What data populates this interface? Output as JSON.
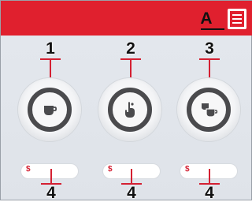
{
  "callouts": {
    "menu": "A",
    "button_1": "1",
    "button_2": "2",
    "button_3": "3",
    "pill_1": "4",
    "pill_2": "4",
    "pill_3": "4"
  },
  "buttons": [
    {
      "icon": "cup-icon"
    },
    {
      "icon": "hand-pour-icon"
    },
    {
      "icon": "double-cup-icon"
    }
  ],
  "pills": [
    {
      "currency": "$"
    },
    {
      "currency": "$"
    },
    {
      "currency": "$"
    }
  ],
  "colors": {
    "brand_red": "#e0202e",
    "ring_dark": "#4a4a4d",
    "screen_bg": "#e2e6ec"
  }
}
